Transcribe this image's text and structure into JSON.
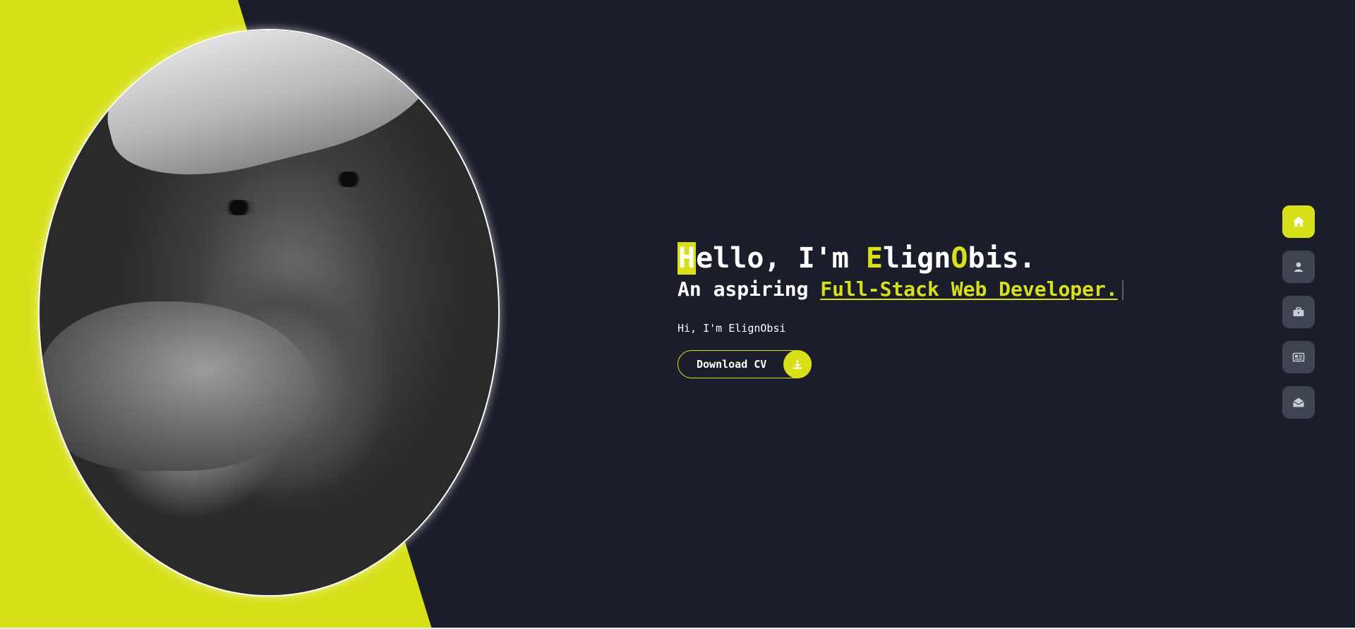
{
  "hero": {
    "greeting_prefix": "ello, I'm ",
    "greeting_highlight_letter": "H",
    "name_first_initial": "E",
    "name_first_rest": "lign",
    "name_last_initial": "O",
    "name_last_rest": "bis.",
    "tagline_prefix": "An aspiring ",
    "tagline_role": "Full-Stack Web Developer.",
    "intro": "Hi, I'm ElignObsi",
    "download_label": "Download CV"
  },
  "nav": {
    "items": [
      {
        "icon": "home-icon",
        "active": true
      },
      {
        "icon": "user-icon",
        "active": false
      },
      {
        "icon": "briefcase-icon",
        "active": false
      },
      {
        "icon": "newspaper-icon",
        "active": false
      },
      {
        "icon": "envelope-open-icon",
        "active": false
      }
    ]
  },
  "colors": {
    "accent": "#d8e01a",
    "background": "#1b1d2b",
    "nav_button": "#3e4452"
  }
}
